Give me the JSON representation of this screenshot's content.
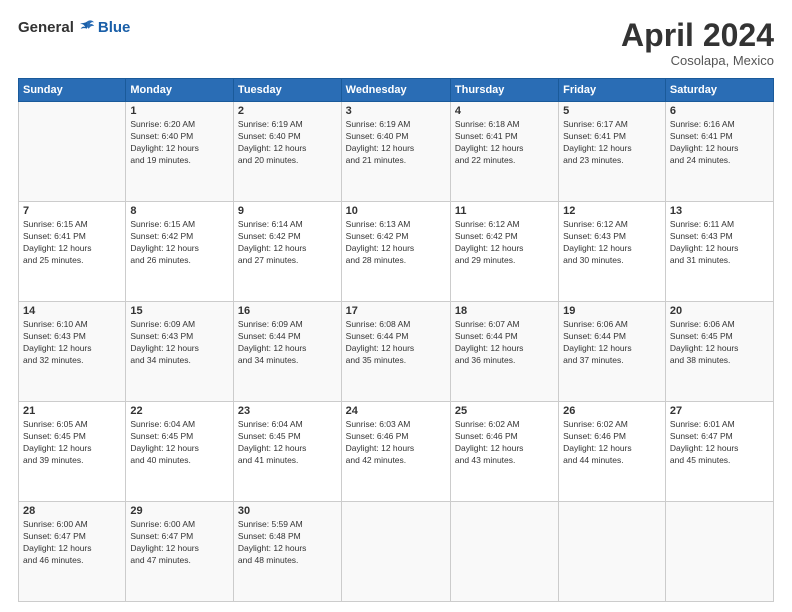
{
  "logo": {
    "general": "General",
    "blue": "Blue"
  },
  "title": "April 2024",
  "location": "Cosolapa, Mexico",
  "days_header": [
    "Sunday",
    "Monday",
    "Tuesday",
    "Wednesday",
    "Thursday",
    "Friday",
    "Saturday"
  ],
  "weeks": [
    [
      {
        "day": "",
        "info": ""
      },
      {
        "day": "1",
        "info": "Sunrise: 6:20 AM\nSunset: 6:40 PM\nDaylight: 12 hours\nand 19 minutes."
      },
      {
        "day": "2",
        "info": "Sunrise: 6:19 AM\nSunset: 6:40 PM\nDaylight: 12 hours\nand 20 minutes."
      },
      {
        "day": "3",
        "info": "Sunrise: 6:19 AM\nSunset: 6:40 PM\nDaylight: 12 hours\nand 21 minutes."
      },
      {
        "day": "4",
        "info": "Sunrise: 6:18 AM\nSunset: 6:41 PM\nDaylight: 12 hours\nand 22 minutes."
      },
      {
        "day": "5",
        "info": "Sunrise: 6:17 AM\nSunset: 6:41 PM\nDaylight: 12 hours\nand 23 minutes."
      },
      {
        "day": "6",
        "info": "Sunrise: 6:16 AM\nSunset: 6:41 PM\nDaylight: 12 hours\nand 24 minutes."
      }
    ],
    [
      {
        "day": "7",
        "info": "Sunrise: 6:15 AM\nSunset: 6:41 PM\nDaylight: 12 hours\nand 25 minutes."
      },
      {
        "day": "8",
        "info": "Sunrise: 6:15 AM\nSunset: 6:42 PM\nDaylight: 12 hours\nand 26 minutes."
      },
      {
        "day": "9",
        "info": "Sunrise: 6:14 AM\nSunset: 6:42 PM\nDaylight: 12 hours\nand 27 minutes."
      },
      {
        "day": "10",
        "info": "Sunrise: 6:13 AM\nSunset: 6:42 PM\nDaylight: 12 hours\nand 28 minutes."
      },
      {
        "day": "11",
        "info": "Sunrise: 6:12 AM\nSunset: 6:42 PM\nDaylight: 12 hours\nand 29 minutes."
      },
      {
        "day": "12",
        "info": "Sunrise: 6:12 AM\nSunset: 6:43 PM\nDaylight: 12 hours\nand 30 minutes."
      },
      {
        "day": "13",
        "info": "Sunrise: 6:11 AM\nSunset: 6:43 PM\nDaylight: 12 hours\nand 31 minutes."
      }
    ],
    [
      {
        "day": "14",
        "info": "Sunrise: 6:10 AM\nSunset: 6:43 PM\nDaylight: 12 hours\nand 32 minutes."
      },
      {
        "day": "15",
        "info": "Sunrise: 6:09 AM\nSunset: 6:43 PM\nDaylight: 12 hours\nand 34 minutes."
      },
      {
        "day": "16",
        "info": "Sunrise: 6:09 AM\nSunset: 6:44 PM\nDaylight: 12 hours\nand 34 minutes."
      },
      {
        "day": "17",
        "info": "Sunrise: 6:08 AM\nSunset: 6:44 PM\nDaylight: 12 hours\nand 35 minutes."
      },
      {
        "day": "18",
        "info": "Sunrise: 6:07 AM\nSunset: 6:44 PM\nDaylight: 12 hours\nand 36 minutes."
      },
      {
        "day": "19",
        "info": "Sunrise: 6:06 AM\nSunset: 6:44 PM\nDaylight: 12 hours\nand 37 minutes."
      },
      {
        "day": "20",
        "info": "Sunrise: 6:06 AM\nSunset: 6:45 PM\nDaylight: 12 hours\nand 38 minutes."
      }
    ],
    [
      {
        "day": "21",
        "info": "Sunrise: 6:05 AM\nSunset: 6:45 PM\nDaylight: 12 hours\nand 39 minutes."
      },
      {
        "day": "22",
        "info": "Sunrise: 6:04 AM\nSunset: 6:45 PM\nDaylight: 12 hours\nand 40 minutes."
      },
      {
        "day": "23",
        "info": "Sunrise: 6:04 AM\nSunset: 6:45 PM\nDaylight: 12 hours\nand 41 minutes."
      },
      {
        "day": "24",
        "info": "Sunrise: 6:03 AM\nSunset: 6:46 PM\nDaylight: 12 hours\nand 42 minutes."
      },
      {
        "day": "25",
        "info": "Sunrise: 6:02 AM\nSunset: 6:46 PM\nDaylight: 12 hours\nand 43 minutes."
      },
      {
        "day": "26",
        "info": "Sunrise: 6:02 AM\nSunset: 6:46 PM\nDaylight: 12 hours\nand 44 minutes."
      },
      {
        "day": "27",
        "info": "Sunrise: 6:01 AM\nSunset: 6:47 PM\nDaylight: 12 hours\nand 45 minutes."
      }
    ],
    [
      {
        "day": "28",
        "info": "Sunrise: 6:00 AM\nSunset: 6:47 PM\nDaylight: 12 hours\nand 46 minutes."
      },
      {
        "day": "29",
        "info": "Sunrise: 6:00 AM\nSunset: 6:47 PM\nDaylight: 12 hours\nand 47 minutes."
      },
      {
        "day": "30",
        "info": "Sunrise: 5:59 AM\nSunset: 6:48 PM\nDaylight: 12 hours\nand 48 minutes."
      },
      {
        "day": "",
        "info": ""
      },
      {
        "day": "",
        "info": ""
      },
      {
        "day": "",
        "info": ""
      },
      {
        "day": "",
        "info": ""
      }
    ]
  ]
}
